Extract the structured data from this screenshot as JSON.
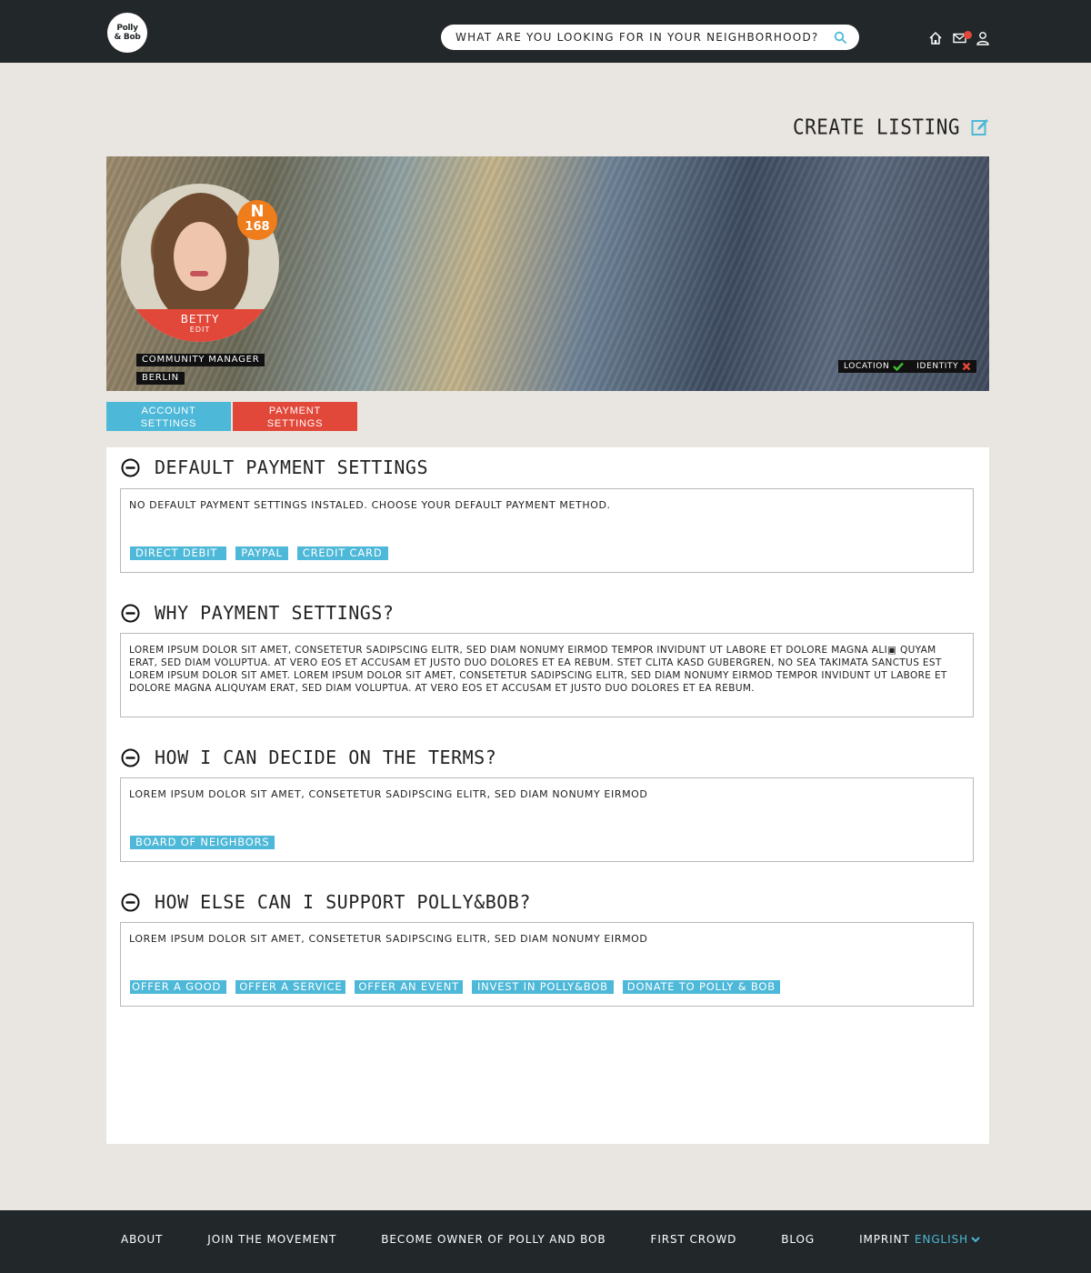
{
  "header": {
    "logo_line1": "Polly",
    "logo_line2": "& Bob",
    "search_placeholder": "WHAT ARE YOU LOOKING FOR IN YOUR NEIGHBORHOOD?",
    "icons": [
      "search-icon",
      "home-icon",
      "mail-icon",
      "user-icon"
    ],
    "notification_color": "#e2483a"
  },
  "create_listing": {
    "label": "CREATE LISTING",
    "icon": "edit-icon"
  },
  "profile": {
    "name": "BETTY",
    "edit": "EDIT",
    "badge_letter": "N",
    "badge_count": "168",
    "role": "COMMUNITY MANAGER",
    "city": "BERLIN",
    "verification": {
      "location_label": "LOCATION",
      "location_verified": true,
      "identity_label": "IDENTITY",
      "identity_verified": false
    }
  },
  "tabs": {
    "account": {
      "line1": "ACCOUNT",
      "line2": "SETTINGS"
    },
    "payment": {
      "line1": "PAYMENT",
      "line2": "SETTINGS"
    }
  },
  "sections": {
    "default_payment": {
      "title": "DEFAULT PAYMENT SETTINGS",
      "text": "NO DEFAULT PAYMENT SETTINGS INSTALED. CHOOSE YOUR DEFAULT PAYMENT METHOD.",
      "buttons": [
        "DIRECT DEBIT",
        "PAYPAL",
        "CREDIT CARD"
      ]
    },
    "why_payment": {
      "title": "WHY PAYMENT SETTINGS?",
      "text": "LOREM IPSUM DOLOR SIT AMET, CONSETETUR SADIPSCING ELITR, SED DIAM NONUMY EIRMOD TEMPOR INVIDUNT UT LABORE ET DOLORE MAGNA ALI▣ QUYAM ERAT, SED DIAM VOLUPTUA. AT VERO EOS ET ACCUSAM ET JUSTO DUO DOLORES ET EA REBUM. STET CLITA KASD GUBERGREN, NO SEA TAKIMATA SANCTUS EST LOREM IPSUM DOLOR SIT AMET. LOREM IPSUM DOLOR SIT AMET, CONSETETUR SADIPSCING ELITR, SED DIAM NONUMY EIRMOD TEMPOR INVIDUNT UT LABORE ET DOLORE MAGNA ALIQUYAM ERAT, SED DIAM VOLUPTUA. AT VERO EOS ET ACCUSAM ET JUSTO DUO DOLORES ET EA REBUM."
    },
    "decide_terms": {
      "title": "HOW I CAN DECIDE ON THE TERMS?",
      "text": "LOREM IPSUM DOLOR SIT AMET, CONSETETUR SADIPSCING ELITR, SED DIAM NONUMY EIRMOD",
      "buttons": [
        "BOARD OF NEIGHBORS"
      ]
    },
    "support": {
      "title": "HOW ELSE CAN I SUPPORT POLLY&BOB?",
      "text": "LOREM IPSUM DOLOR SIT AMET, CONSETETUR SADIPSCING ELITR, SED DIAM NONUMY EIRMOD",
      "buttons": [
        "OFFER A GOOD",
        "OFFER A SERVICE",
        "OFFER AN EVENT",
        "INVEST IN POLLY&BOB",
        "DONATE TO POLLY & BOB"
      ]
    }
  },
  "footer": {
    "links": [
      "ABOUT",
      "JOIN THE MOVEMENT",
      "BECOME OWNER OF POLLY AND BOB",
      "FIRST CROWD",
      "BLOG",
      "IMPRINT"
    ],
    "language": "ENGLISH"
  },
  "colors": {
    "accent_blue": "#4db8d8",
    "accent_red": "#e2483a",
    "badge_orange": "#f07d1c",
    "dark_bar": "#22282a",
    "page_bg": "#e9e6e1"
  }
}
